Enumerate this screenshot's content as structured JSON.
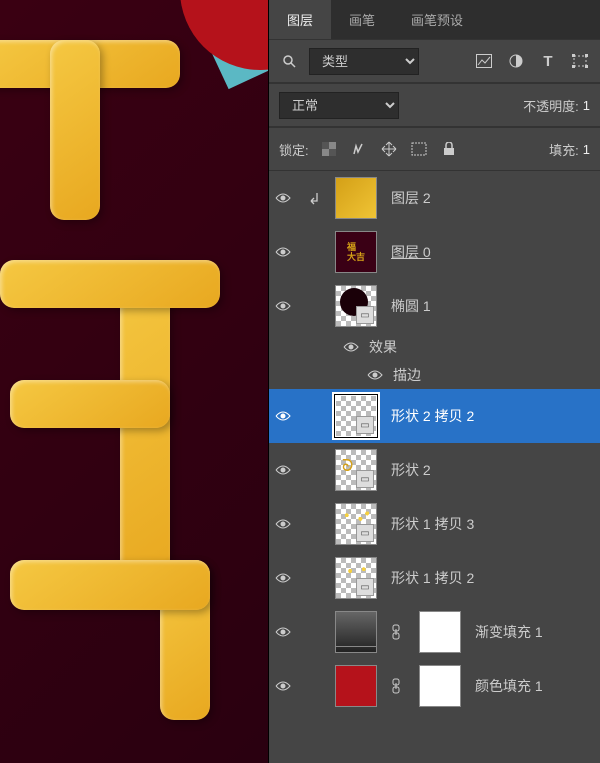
{
  "tabs": {
    "layers": "图层",
    "brush": "画笔",
    "brush_presets": "画笔预设"
  },
  "filter": {
    "label": "类型"
  },
  "blend": {
    "mode": "正常",
    "opacity_label": "不透明度:",
    "opacity_val": "1"
  },
  "lock": {
    "label": "锁定:",
    "fill_label": "填充:",
    "fill_val": "1"
  },
  "layers": [
    {
      "name": "图层 2"
    },
    {
      "name": "图层 0"
    },
    {
      "name": "椭圆 1"
    },
    {
      "name": "效果"
    },
    {
      "name": "描边"
    },
    {
      "name": "形状 2 拷贝 2"
    },
    {
      "name": "形状 2"
    },
    {
      "name": "形状 1 拷贝 3"
    },
    {
      "name": "形状 1 拷贝 2"
    },
    {
      "name": "渐变填充 1"
    },
    {
      "name": "颜色填充 1"
    }
  ]
}
